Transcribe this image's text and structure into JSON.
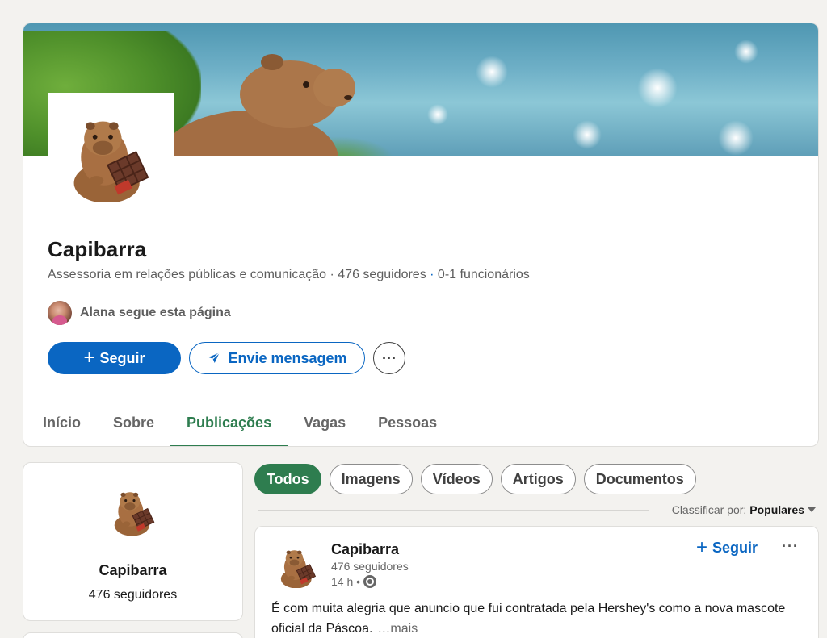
{
  "company": {
    "name": "Capibarra",
    "industry": "Assessoria em relações públicas e comunicação",
    "sep1": " · ",
    "followers": "476 seguidores",
    "sep2": " · ",
    "employees": "0-1 funcionários"
  },
  "follower_line": {
    "text": "Alana segue esta página"
  },
  "actions": {
    "follow_label": "Seguir",
    "message_label": "Envie mensagem",
    "more_label": "···"
  },
  "tabs": [
    {
      "label": "Início",
      "active": false
    },
    {
      "label": "Sobre",
      "active": false
    },
    {
      "label": "Publicações",
      "active": true
    },
    {
      "label": "Vagas",
      "active": false
    },
    {
      "label": "Pessoas",
      "active": false
    }
  ],
  "side_card": {
    "name": "Capibarra",
    "followers": "476 seguidores"
  },
  "filters": [
    {
      "label": "Todos",
      "active": true
    },
    {
      "label": "Imagens",
      "active": false
    },
    {
      "label": "Vídeos",
      "active": false
    },
    {
      "label": "Artigos",
      "active": false
    },
    {
      "label": "Documentos",
      "active": false
    }
  ],
  "sort": {
    "prefix": "Classificar por:",
    "value": "Populares"
  },
  "post": {
    "author": "Capibarra",
    "followers": "476 seguidores",
    "time": "14 h •",
    "follow_label": "Seguir",
    "more_label": "···",
    "text": "É com muita alegria que anuncio que fui contratada pela Hershey's como a nova mascote oficial da Páscoa.",
    "see_more": "…mais"
  },
  "colors": {
    "accent_blue": "#0a66c2",
    "active_green": "#2e7d4f",
    "page_bg": "#f3f2ef"
  }
}
